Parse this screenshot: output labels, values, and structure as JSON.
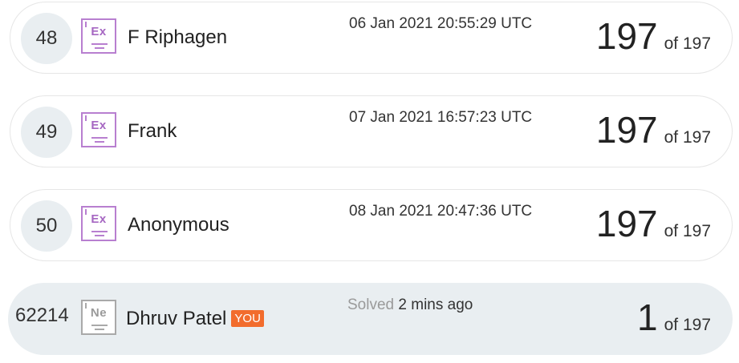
{
  "rows": [
    {
      "rank": "48",
      "badge_symbol": "Ex",
      "name": "F Riphagen",
      "date": "06 Jan 2021 20:55:29 UTC",
      "score": "197",
      "of_total": "of 197"
    },
    {
      "rank": "49",
      "badge_symbol": "Ex",
      "name": "Frank",
      "date": "07 Jan 2021 16:57:23 UTC",
      "score": "197",
      "of_total": "of 197"
    },
    {
      "rank": "50",
      "badge_symbol": "Ex",
      "name": "Anonymous",
      "date": "08 Jan 2021 20:47:36 UTC",
      "score": "197",
      "of_total": "of 197"
    }
  ],
  "current_user": {
    "rank": "62214",
    "badge_symbol": "Ne",
    "name": "Dhruv Patel",
    "you_tag": "YOU",
    "solved_label": "Solved",
    "solved_time": "2 mins ago",
    "score": "1",
    "of_total": "of 197"
  },
  "colors": {
    "expert_badge": "#b87fd0",
    "newbie_badge": "#a9a9a9",
    "you_tag": "#f26c2d",
    "highlight_row": "#e9eef1"
  }
}
